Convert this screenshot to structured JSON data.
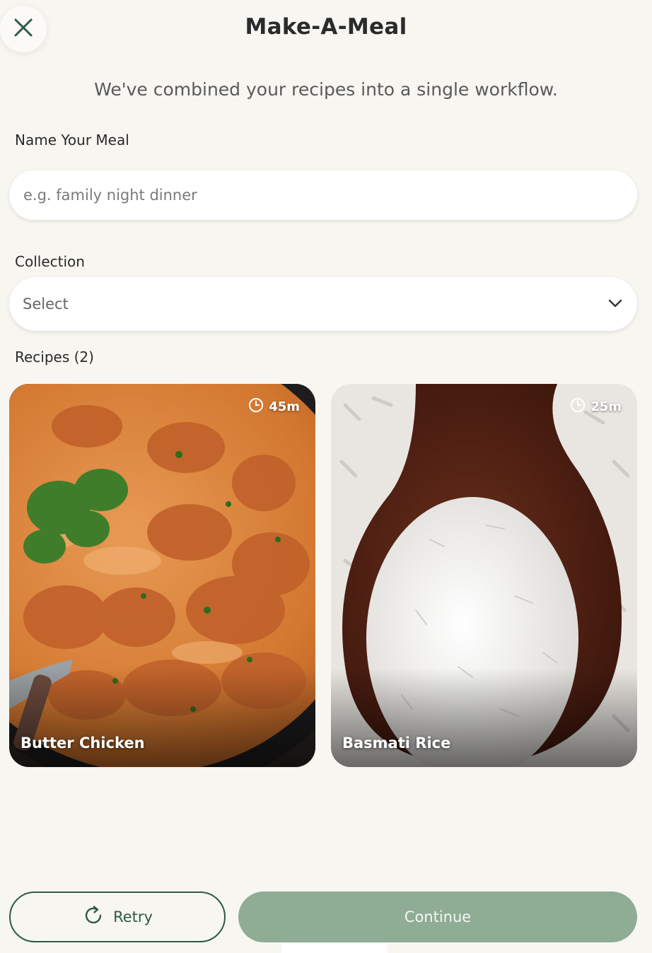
{
  "header": {
    "title": "Make-A-Meal",
    "subtitle": "We've combined your recipes into a single workflow."
  },
  "name_field": {
    "label": "Name Your Meal",
    "placeholder": "e.g. family night dinner",
    "value": ""
  },
  "collection": {
    "label": "Collection",
    "selected": "Select"
  },
  "recipes": {
    "heading": "Recipes (2)",
    "items": [
      {
        "title": "Butter Chicken",
        "time": "45m",
        "icon": "clock-icon"
      },
      {
        "title": "Basmati Rice",
        "time": "25m",
        "icon": "clock-icon"
      }
    ]
  },
  "actions": {
    "retry_label": "Retry",
    "continue_label": "Continue"
  },
  "colors": {
    "background": "#f8f6f1",
    "accent_green": "#2e5a45",
    "continue_button": "#8fac94"
  },
  "icons": {
    "close": "close-icon",
    "dropdown": "chevron-down-icon",
    "retry": "refresh-icon"
  }
}
